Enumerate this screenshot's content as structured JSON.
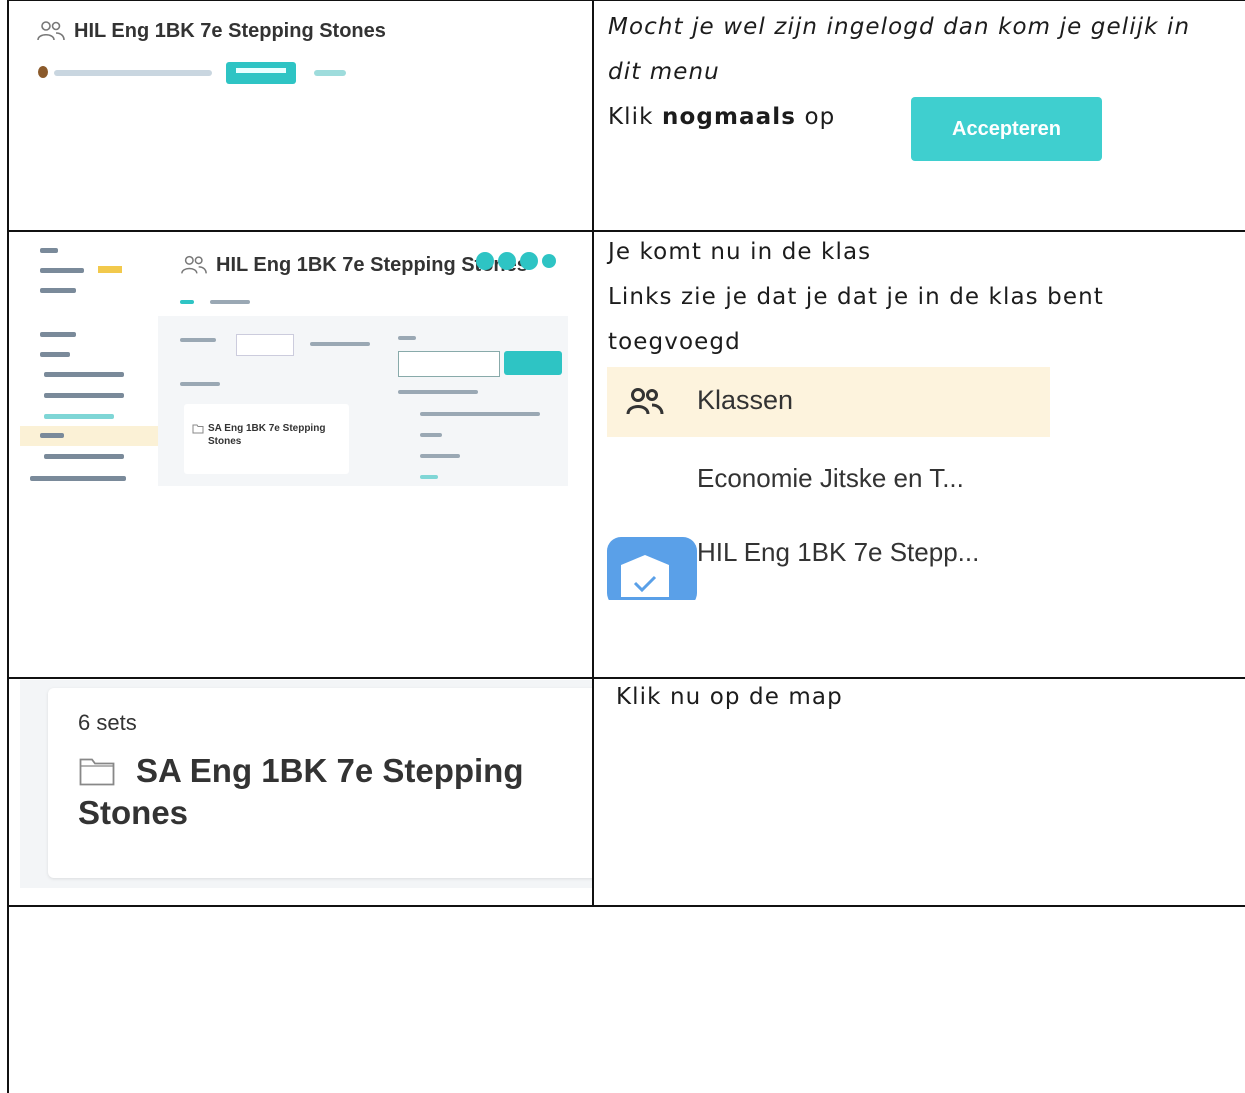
{
  "row1": {
    "screenshot_title": "HIL Eng 1BK 7e Stepping Stones",
    "text_line1": "Mocht je wel zijn ingelogd dan kom je gelijk in",
    "text_line2": "dit menu",
    "text_line3_prefix": "Klik ",
    "text_line3_bold": "nogmaals",
    "text_line3_suffix": " op",
    "accept_button": "Accepteren"
  },
  "row2": {
    "screenshot_title": "HIL Eng 1BK 7e Stepping Stones",
    "card_title": "SA Eng 1BK 7e Stepping Stones",
    "text_line1": "Je komt nu in de klas",
    "text_line2": "Links zie je dat je dat je in de klas bent",
    "text_line3": "toegvoegd",
    "klassen_label": "Klassen",
    "class_item1": "Economie Jitske en T...",
    "class_item2": "HIL Eng 1BK 7e Stepp..."
  },
  "row3": {
    "sets_count": "6 sets",
    "folder_name": "SA Eng 1BK 7e Stepping Stones",
    "text_line1": "Klik nu op de map"
  },
  "colors": {
    "accent": "#3fcfcf",
    "klassen_bg": "#fdf3dd",
    "shield": "#5aa0e8"
  }
}
